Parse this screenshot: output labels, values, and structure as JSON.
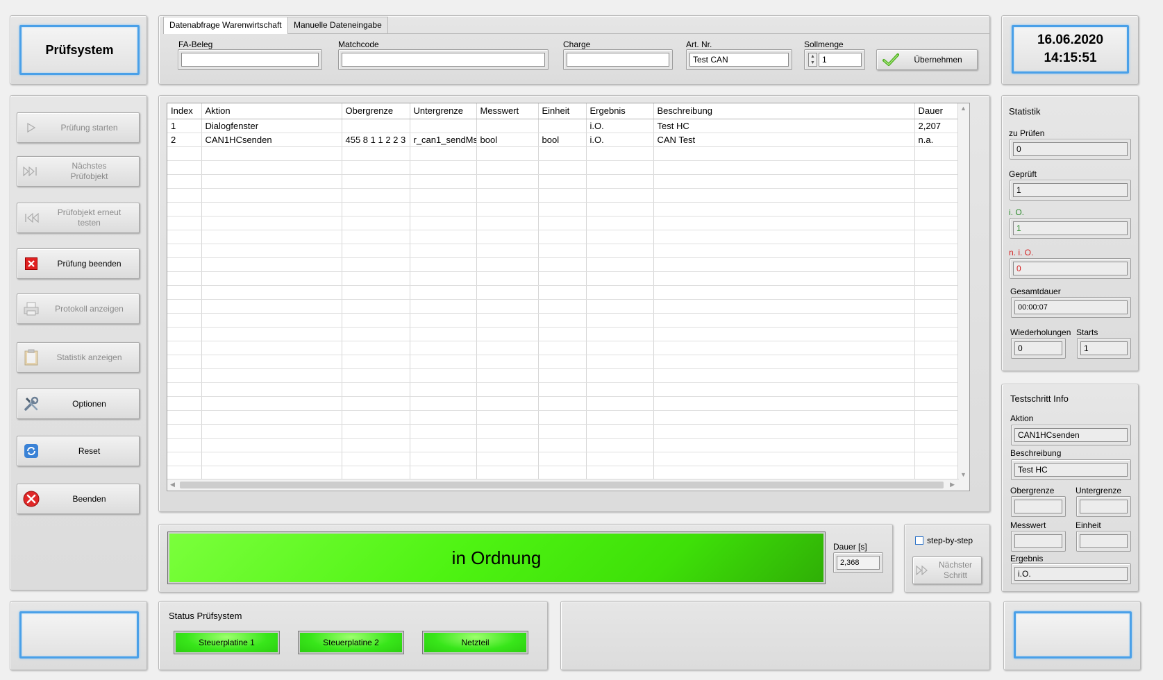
{
  "title": "Prüfsystem",
  "datetime": {
    "date": "16.06.2020",
    "time": "14:15:51"
  },
  "tabs": [
    {
      "label": "Datenabfrage Warenwirtschaft"
    },
    {
      "label": "Manuelle Dateneingabe"
    }
  ],
  "entry": {
    "fa_beleg_label": "FA-Beleg",
    "fa_beleg_value": "",
    "matchcode_label": "Matchcode",
    "matchcode_value": "",
    "charge_label": "Charge",
    "charge_value": "",
    "artnr_label": "Art. Nr.",
    "artnr_value": "Test CAN",
    "sollmenge_label": "Sollmenge",
    "sollmenge_value": "1",
    "uebernehmen_label": "Übernehmen"
  },
  "sidebar": {
    "start": "Prüfung starten",
    "next_line1": "Nächstes",
    "next_line2": "Prüfobjekt",
    "retest_line1": "Prüfobjekt erneut",
    "retest_line2": "testen",
    "end_test": "Prüfung beenden",
    "protocol": "Protokoll anzeigen",
    "statistics": "Statistik anzeigen",
    "options": "Optionen",
    "reset": "Reset",
    "quit": "Beenden"
  },
  "table": {
    "columns": [
      "Index",
      "Aktion",
      "Obergrenze",
      "Untergrenze",
      "Messwert",
      "Einheit",
      "Ergebnis",
      "Beschreibung",
      "Dauer"
    ],
    "rows": [
      [
        "1",
        "Dialogfenster",
        "",
        "",
        "",
        "",
        "i.O.",
        "Test HC",
        "2,207"
      ],
      [
        "2",
        "CAN1HCsenden",
        "455 8 1 1 2 2 3",
        "r_can1_sendMs",
        "bool",
        "bool",
        "i.O.",
        "CAN Test",
        "n.a."
      ]
    ]
  },
  "result": {
    "text": "in Ordnung",
    "dauer_label": "Dauer [s]",
    "dauer_value": "2,368",
    "color": "#44ee10"
  },
  "stepper": {
    "checkbox_label": "step-by-step",
    "next_line1": "Nächster",
    "next_line2": "Schritt"
  },
  "status": {
    "title": "Status Prüfsystem",
    "items": [
      "Steuerplatine 1",
      "Steuerplatine 2",
      "Netzteil"
    ]
  },
  "statistik": {
    "title": "Statistik",
    "zu_pruefen_label": "zu Prüfen",
    "zu_pruefen_value": "0",
    "geprueft_label": "Geprüft",
    "geprueft_value": "1",
    "io_label": "i. O.",
    "io_value": "1",
    "nio_label": "n. i. O.",
    "nio_value": "0",
    "gesamtdauer_label": "Gesamtdauer",
    "gesamtdauer_value": "00:00:07",
    "wiederholungen_label": "Wiederholungen",
    "wiederholungen_value": "0",
    "starts_label": "Starts",
    "starts_value": "1",
    "io_color": "#2a8a2a",
    "nio_color": "#d42020"
  },
  "testschritt": {
    "title": "Testschritt Info",
    "aktion_label": "Aktion",
    "aktion_value": "CAN1HCsenden",
    "beschreibung_label": "Beschreibung",
    "beschreibung_value": "Test HC",
    "obergrenze_label": "Obergrenze",
    "obergrenze_value": "",
    "untergrenze_label": "Untergrenze",
    "untergrenze_value": "",
    "messwert_label": "Messwert",
    "messwert_value": "",
    "einheit_label": "Einheit",
    "einheit_value": "",
    "ergebnis_label": "Ergebnis",
    "ergebnis_value": "i.O."
  }
}
